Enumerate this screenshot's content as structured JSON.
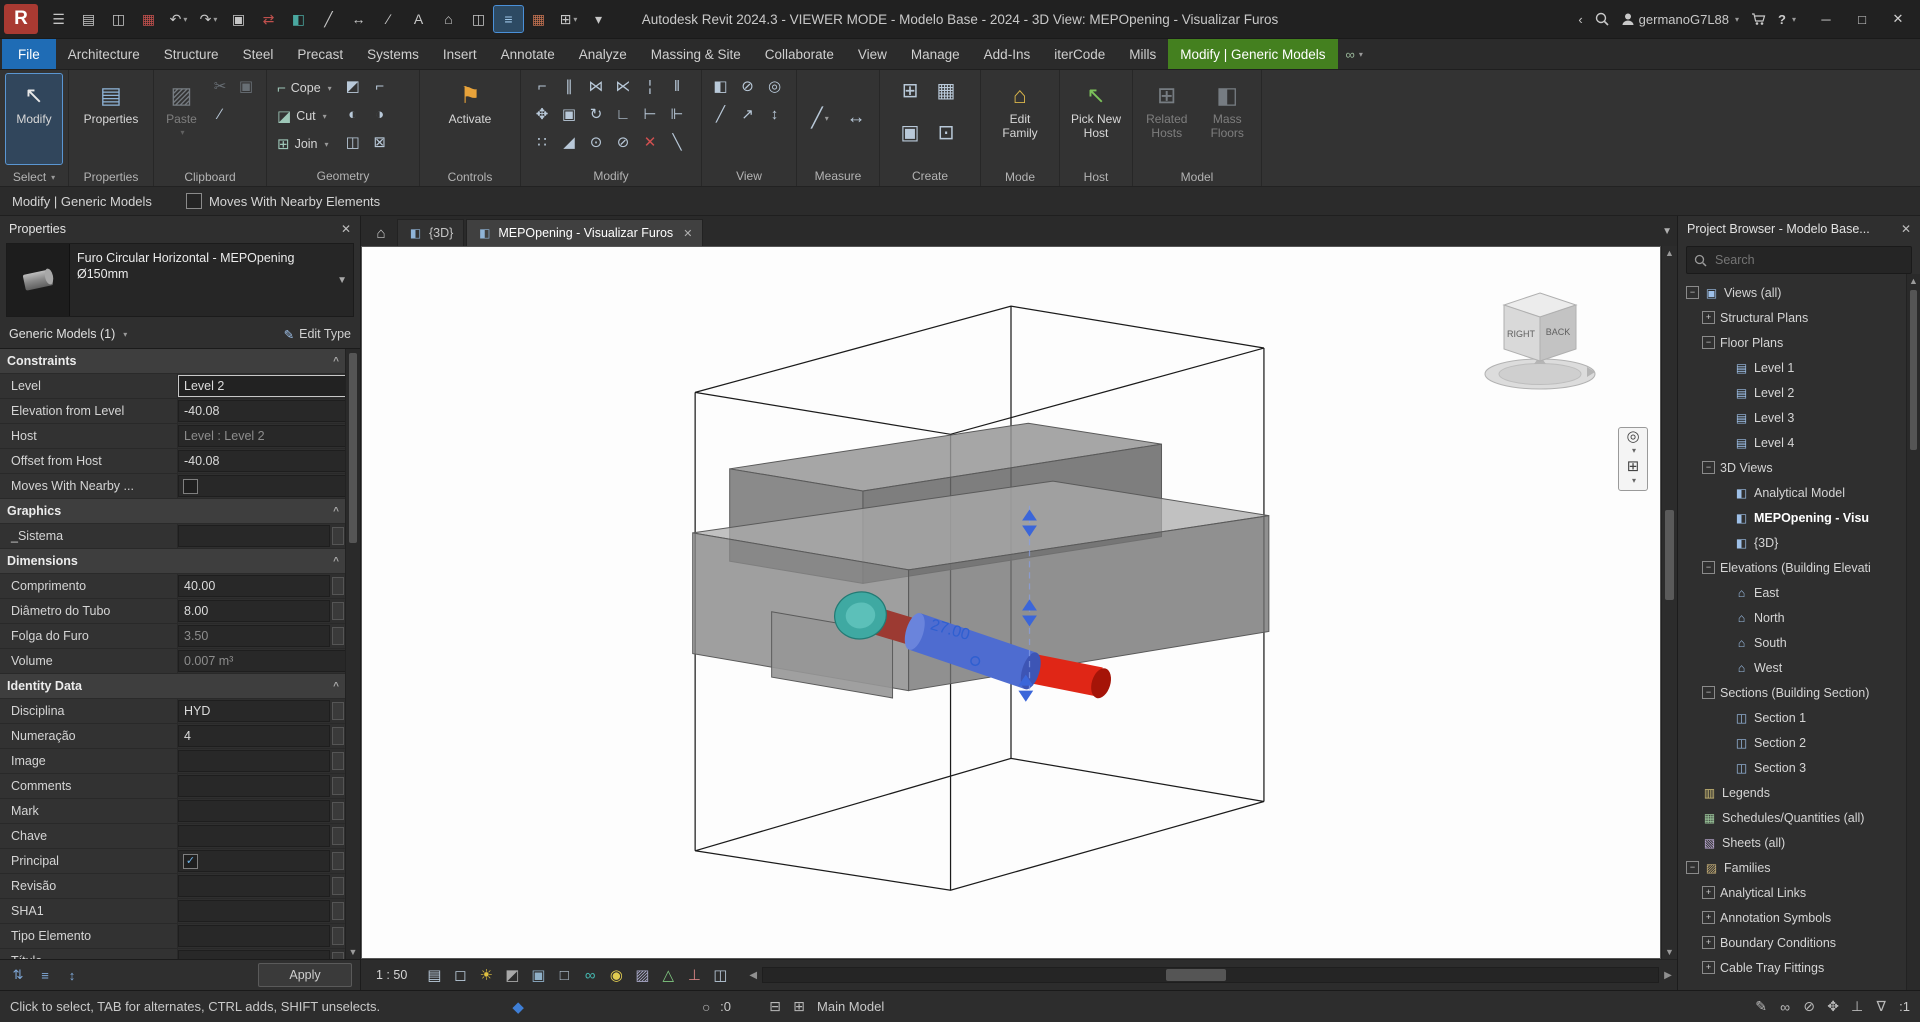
{
  "window": {
    "title": "Autodesk Revit 2024.3 - VIEWER MODE - Modelo Base - 2024 - 3D View: MEPOpening - Visualizar Furos",
    "user": "germanoG7L88",
    "logo": "R"
  },
  "qat": [
    {
      "name": "file-menu-icon",
      "glyph": "☰"
    },
    {
      "name": "open-icon",
      "glyph": "▤"
    },
    {
      "name": "save-icon",
      "glyph": "◫"
    },
    {
      "name": "print-preview-icon",
      "glyph": "▦",
      "color": "#c0504d"
    },
    {
      "name": "undo-icon",
      "glyph": "↶",
      "caret": true
    },
    {
      "name": "redo-icon",
      "glyph": "↷",
      "caret": true
    },
    {
      "name": "print-icon",
      "glyph": "▣"
    },
    {
      "name": "transfer-standards-icon",
      "glyph": "⇄",
      "color": "#c0504d"
    },
    {
      "name": "insert-views-icon",
      "glyph": "◧",
      "color": "#4aa8a0"
    },
    {
      "name": "measure-icon",
      "glyph": "╱"
    },
    {
      "name": "aligned-dimension-icon",
      "glyph": "↔"
    },
    {
      "name": "model-line-icon",
      "glyph": "∕"
    },
    {
      "name": "text-icon",
      "glyph": "A"
    },
    {
      "name": "default-3d-view-icon",
      "glyph": "⌂"
    },
    {
      "name": "section-icon",
      "glyph": "◫"
    },
    {
      "name": "thin-lines-icon",
      "glyph": "≡",
      "active": true
    },
    {
      "name": "schedules-icon",
      "glyph": "▦",
      "color": "#c07050"
    },
    {
      "name": "switch-windows-icon",
      "glyph": "⊞",
      "caret": true
    },
    {
      "name": "qat-customize-icon",
      "glyph": "▾"
    }
  ],
  "ribbon": {
    "tabs": [
      {
        "label": "File",
        "type": "file"
      },
      {
        "label": "Architecture"
      },
      {
        "label": "Structure"
      },
      {
        "label": "Steel"
      },
      {
        "label": "Precast"
      },
      {
        "label": "Systems"
      },
      {
        "label": "Insert"
      },
      {
        "label": "Annotate"
      },
      {
        "label": "Analyze"
      },
      {
        "label": "Massing & Site"
      },
      {
        "label": "Collaborate"
      },
      {
        "label": "View"
      },
      {
        "label": "Manage"
      },
      {
        "label": "Add-Ins"
      },
      {
        "label": "iterCode"
      },
      {
        "label": "Mills"
      },
      {
        "label": "Modify | Generic Models",
        "type": "contextual"
      }
    ],
    "panels": {
      "select": {
        "label": "Select",
        "button": "Modify"
      },
      "properties": {
        "label": "Properties",
        "button": "Properties"
      },
      "clipboard": {
        "label": "Clipboard",
        "paste": "Paste",
        "icons": [
          {
            "name": "cut-icon",
            "glyph": "✂",
            "grayed": true
          },
          {
            "name": "copy-icon",
            "glyph": "▣",
            "grayed": true
          },
          {
            "name": "match-type-icon",
            "glyph": "∕"
          }
        ]
      },
      "geometry": {
        "label": "Geometry",
        "rows": [
          {
            "name": "cope-button",
            "label": "Cope",
            "glyph": "⌐"
          },
          {
            "name": "cut-button",
            "label": "Cut",
            "glyph": "◪"
          },
          {
            "name": "join-button",
            "label": "Join",
            "glyph": "⊞"
          }
        ],
        "icons": [
          {
            "name": "cut-profile-icon",
            "glyph": "◩"
          },
          {
            "name": "apply-coping-icon",
            "glyph": "⌐"
          },
          {
            "name": "paint-icon",
            "glyph": "◐"
          },
          {
            "name": "remove-paint-icon",
            "glyph": "◑"
          },
          {
            "name": "split-face-icon",
            "glyph": "◫"
          },
          {
            "name": "demolish-icon",
            "glyph": "⊠"
          }
        ]
      },
      "controls": {
        "label": "Controls",
        "button": "Activate"
      },
      "modify": {
        "label": "Modify",
        "icons": [
          {
            "name": "align-icon",
            "glyph": "⌐"
          },
          {
            "name": "offset-icon",
            "glyph": "∥"
          },
          {
            "name": "mirror-pick-axis-icon",
            "glyph": "⋈"
          },
          {
            "name": "mirror-draw-axis-icon",
            "glyph": "⋉"
          },
          {
            "name": "split-element-icon",
            "glyph": "¦"
          },
          {
            "name": "split-with-gap-icon",
            "glyph": "‖"
          },
          {
            "name": "move-icon",
            "glyph": "✥"
          },
          {
            "name": "copy-icon",
            "glyph": "▣"
          },
          {
            "name": "rotate-icon",
            "glyph": "↻"
          },
          {
            "name": "trim-extend-corner-icon",
            "glyph": "∟"
          },
          {
            "name": "trim-extend-single-icon",
            "glyph": "⊢"
          },
          {
            "name": "trim-extend-multiple-icon",
            "glyph": "⊩"
          },
          {
            "name": "array-icon",
            "glyph": "∷"
          },
          {
            "name": "scale-icon",
            "glyph": "◢"
          },
          {
            "name": "pin-icon",
            "glyph": "⊙"
          },
          {
            "name": "unpin-icon",
            "glyph": "⊘"
          },
          {
            "name": "delete-icon",
            "glyph": "✕",
            "color": "#d05050"
          },
          {
            "name": "match-line-icon",
            "glyph": "╲"
          }
        ]
      },
      "view": {
        "label": "View",
        "icons": [
          {
            "name": "override-graphics-icon",
            "glyph": "◧"
          },
          {
            "name": "hide-in-view-icon",
            "glyph": "⊘"
          },
          {
            "name": "isolate-icon",
            "glyph": "◎"
          },
          {
            "name": "linework-icon",
            "glyph": "╱"
          },
          {
            "name": "displace-elements-icon",
            "glyph": "↗"
          },
          {
            "name": "view-range-icon",
            "glyph": "↕"
          }
        ]
      },
      "measure": {
        "label": "Measure",
        "icons": [
          {
            "name": "measure-between-icon",
            "glyph": "╱",
            "caret": true
          },
          {
            "name": "dimension-icon",
            "glyph": "↔"
          }
        ]
      },
      "create": {
        "label": "Create",
        "icons": [
          {
            "name": "create-parts-icon",
            "glyph": "⊞"
          },
          {
            "name": "create-assembly-icon",
            "glyph": "▦"
          },
          {
            "name": "create-similar-icon",
            "glyph": "▣"
          },
          {
            "name": "create-group-icon",
            "glyph": "⊡"
          }
        ]
      },
      "mode": {
        "label": "Mode",
        "button": "Edit Family"
      },
      "host": {
        "label": "Host",
        "button": "Pick New Host"
      },
      "model": {
        "label": "Model",
        "buttons": [
          "Related Hosts",
          "Mass Floors"
        ]
      }
    }
  },
  "options_bar": {
    "context": "Modify | Generic Models",
    "checkbox": "Moves With Nearby Elements"
  },
  "properties_panel": {
    "title": "Properties",
    "type_name": "Furo Circular Horizontal - MEPOpening",
    "type_size": "Ø150mm",
    "category": "Generic Models (1)",
    "edit_type": "Edit Type",
    "apply": "Apply",
    "groups": [
      {
        "name": "Constraints",
        "rows": [
          {
            "label": "Level",
            "value": "Level 2",
            "focused": true
          },
          {
            "label": "Elevation from Level",
            "value": "-40.08"
          },
          {
            "label": "Host",
            "value": "Level : Level 2",
            "disabled": true
          },
          {
            "label": "Offset from Host",
            "value": "-40.08"
          },
          {
            "label": "Moves With Nearby ...",
            "checkbox": true,
            "checked": false
          }
        ]
      },
      {
        "name": "Graphics",
        "rows": [
          {
            "label": "_Sistema",
            "value": "",
            "assoc": true
          }
        ]
      },
      {
        "name": "Dimensions",
        "rows": [
          {
            "label": "Comprimento",
            "value": "40.00",
            "assoc": true
          },
          {
            "label": "Diâmetro do Tubo",
            "value": "8.00",
            "assoc": true
          },
          {
            "label": "Folga do Furo",
            "value": "3.50",
            "disabled": true,
            "assoc": true
          },
          {
            "label": "Volume",
            "value": "0.007 m³",
            "disabled": true
          }
        ]
      },
      {
        "name": "Identity Data",
        "rows": [
          {
            "label": "Disciplina",
            "value": "HYD",
            "assoc": true
          },
          {
            "label": "Numeração",
            "value": "4",
            "assoc": true
          },
          {
            "label": "Image",
            "value": "",
            "assoc": true
          },
          {
            "label": "Comments",
            "value": "",
            "assoc": true
          },
          {
            "label": "Mark",
            "value": "",
            "assoc": true
          },
          {
            "label": "Chave",
            "value": "",
            "assoc": true
          },
          {
            "label": "Principal",
            "checkbox": true,
            "checked": true,
            "assoc": true
          },
          {
            "label": "Revisão",
            "value": "",
            "assoc": true
          },
          {
            "label": "SHA1",
            "value": "",
            "assoc": true
          },
          {
            "label": "Tipo Elemento",
            "value": "",
            "assoc": true
          },
          {
            "label": "Título",
            "value": "",
            "assoc": true
          }
        ]
      }
    ]
  },
  "canvas": {
    "tabs": [
      {
        "label": "{3D}",
        "icon": "view3d"
      },
      {
        "label": "MEPOpening - Visualizar Furos",
        "icon": "view3d",
        "active": true,
        "closable": true
      }
    ],
    "dimension": "27.00",
    "viewcube": {
      "left_face": "RIGHT",
      "right_face": "BACK"
    },
    "view_control": {
      "scale": "1 : 50",
      "icons": [
        {
          "name": "detail-level-icon",
          "glyph": "▤"
        },
        {
          "name": "visual-style-icon",
          "glyph": "◻"
        },
        {
          "name": "sun-path-icon",
          "glyph": "☀",
          "color": "#e0c040"
        },
        {
          "name": "shadows-icon",
          "glyph": "◩",
          "color": "#a8a8a8"
        },
        {
          "name": "crop-view-icon",
          "glyph": "▣",
          "color": "#8fb0c8"
        },
        {
          "name": "show-crop-icon",
          "glyph": "□"
        },
        {
          "name": "temporary-hide-isolate-icon",
          "glyph": "∞",
          "color": "#45b8b0"
        },
        {
          "name": "reveal-hidden-elements-icon",
          "glyph": "◉",
          "color": "#e0cb50"
        },
        {
          "name": "temporary-view-properties-icon",
          "glyph": "▨",
          "color": "#a8a8c8"
        },
        {
          "name": "show-analytical-model-icon",
          "glyph": "△",
          "color": "#80c880"
        },
        {
          "name": "reveal-constraints-icon",
          "glyph": "⊥",
          "color": "#d08080"
        },
        {
          "name": "worksharing-display-icon",
          "glyph": "◫"
        }
      ]
    }
  },
  "project_browser": {
    "title": "Project Browser - Modelo Base...",
    "search_placeholder": "Search",
    "tree": [
      {
        "label": "Views (all)",
        "depth": 0,
        "expander": "minus",
        "icon": "views"
      },
      {
        "label": "Structural Plans",
        "depth": 1,
        "expander": "plus"
      },
      {
        "label": "Floor Plans",
        "depth": 1,
        "expander": "minus"
      },
      {
        "label": "Level 1",
        "depth": 2,
        "icon": "plan"
      },
      {
        "label": "Level 2",
        "depth": 2,
        "icon": "plan"
      },
      {
        "label": "Level 3",
        "depth": 2,
        "icon": "plan"
      },
      {
        "label": "Level 4",
        "depth": 2,
        "icon": "plan"
      },
      {
        "label": "3D Views",
        "depth": 1,
        "expander": "minus"
      },
      {
        "label": "Analytical Model",
        "depth": 2,
        "icon": "view3d"
      },
      {
        "label": "MEPOpening - Visu",
        "depth": 2,
        "icon": "view3d",
        "bold": true
      },
      {
        "label": "{3D}",
        "depth": 2,
        "icon": "view3d"
      },
      {
        "label": "Elevations (Building Elevati",
        "depth": 1,
        "expander": "minus"
      },
      {
        "label": "East",
        "depth": 2,
        "icon": "elevation"
      },
      {
        "label": "North",
        "depth": 2,
        "icon": "elevation"
      },
      {
        "label": "South",
        "depth": 2,
        "icon": "elevation"
      },
      {
        "label": "West",
        "depth": 2,
        "icon": "elevation"
      },
      {
        "label": "Sections (Building Section)",
        "depth": 1,
        "expander": "minus"
      },
      {
        "label": "Section 1",
        "depth": 2,
        "icon": "section"
      },
      {
        "label": "Section 2",
        "depth": 2,
        "icon": "section"
      },
      {
        "label": "Section 3",
        "depth": 2,
        "icon": "section"
      },
      {
        "label": "Legends",
        "depth": 0,
        "icon": "legend"
      },
      {
        "label": "Schedules/Quantities (all)",
        "depth": 0,
        "icon": "schedule"
      },
      {
        "label": "Sheets (all)",
        "depth": 0,
        "icon": "sheet"
      },
      {
        "label": "Families",
        "depth": 0,
        "expander": "minus",
        "icon": "family"
      },
      {
        "label": "Analytical Links",
        "depth": 1,
        "expander": "plus"
      },
      {
        "label": "Annotation Symbols",
        "depth": 1,
        "expander": "plus"
      },
      {
        "label": "Boundary Conditions",
        "depth": 1,
        "expander": "plus"
      },
      {
        "label": "Cable Tray Fittings",
        "depth": 1,
        "expander": "plus"
      }
    ]
  },
  "status_bar": {
    "hint": "Click to select, TAB for alternates, CTRL adds, SHIFT unselects.",
    "processes_label": ":0",
    "workset_label": "Main Model",
    "filter_count": ":1",
    "workset_icons": [
      {
        "name": "worksets-icon",
        "glyph": "⊟"
      },
      {
        "name": "design-options-icon",
        "glyph": "⊞"
      }
    ],
    "right_icons": [
      {
        "name": "editable-only-icon",
        "glyph": "✎"
      },
      {
        "name": "link-icon",
        "glyph": "∞"
      },
      {
        "name": "exclude-options-icon",
        "glyph": "⊘"
      },
      {
        "name": "press-drag-icon",
        "glyph": "✥"
      },
      {
        "name": "reveal-constraints-icon",
        "glyph": "⊥"
      },
      {
        "name": "filter-icon",
        "glyph": "∇"
      }
    ]
  }
}
